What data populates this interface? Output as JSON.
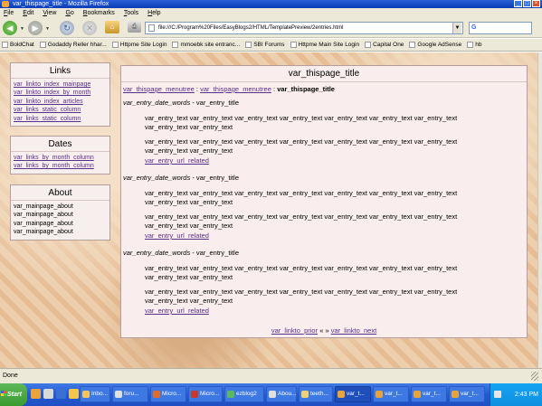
{
  "window": {
    "title": "var_thispage_title - Mozilla Firefox"
  },
  "menu": [
    "File",
    "Edit",
    "View",
    "Go",
    "Bookmarks",
    "Tools",
    "Help"
  ],
  "toolbar": {
    "url": "file:///C:/Program%20Files/EasyBlogs2/HTML/TemplatePreview/2entries.html"
  },
  "bookmarks": [
    "BoldChat",
    "Godaddy Reller hhar...",
    "Httpme Site Login",
    "mmoebk site entranc...",
    "SBI Forums",
    "Httpme Main Site Login",
    "Capital One",
    "Google AdSense",
    "hb"
  ],
  "sidebar": {
    "links": {
      "title": "Links",
      "items": [
        "var_linkto_index_mainpage",
        "var_linkto_index_by_month",
        "var_linkto_index_articles",
        "var_links_static_column",
        "var_links_static_column"
      ]
    },
    "dates": {
      "title": "Dates",
      "items": [
        "var_links_by_month_column",
        "var_links_by_month_column"
      ]
    },
    "about": {
      "title": "About",
      "items": [
        "var_mainpage_about",
        "var_mainpage_about",
        "var_mainpage_about",
        "var_mainpage_about"
      ]
    }
  },
  "main": {
    "title": "var_thispage_title",
    "breadcrumb": {
      "link1": "var_thispage_menutree",
      "sep1": ":",
      "link2": "var_thispage_menutree",
      "sep2": ":",
      "current": "var_thispage_title"
    },
    "entries": [
      {
        "date_words": "var_entry_date_words",
        "dash": "-",
        "title": "var_entry_title",
        "para1": "var_entry_text var_entry_text var_entry_text var_entry_text var_entry_text var_entry_text var_entry_text var_entry_text var_entry_text",
        "para2": "var_entry_text var_entry_text var_entry_text var_entry_text var_entry_text var_entry_text var_entry_text var_entry_text var_entry_text",
        "related": "var_entry_url_related"
      },
      {
        "date_words": "var_entry_date_words",
        "dash": "-",
        "title": "var_entry_title",
        "para1": "var_entry_text var_entry_text var_entry_text var_entry_text var_entry_text var_entry_text var_entry_text var_entry_text var_entry_text",
        "para2": "var_entry_text var_entry_text var_entry_text var_entry_text var_entry_text var_entry_text var_entry_text var_entry_text var_entry_text",
        "related": "var_entry_url_related"
      },
      {
        "date_words": "var_entry_date_words",
        "dash": "-",
        "title": "var_entry_title",
        "para1": "var_entry_text var_entry_text var_entry_text var_entry_text var_entry_text var_entry_text var_entry_text var_entry_text var_entry_text",
        "para2": "var_entry_text var_entry_text var_entry_text var_entry_text var_entry_text var_entry_text var_entry_text var_entry_text var_entry_text",
        "related": "var_entry_url_related"
      }
    ],
    "pager": {
      "prior": "var_linkto_prior",
      "sep_left": "«",
      "sep_right": "»",
      "next": "var_linkto_next"
    }
  },
  "status": {
    "text": "Done"
  },
  "taskbar": {
    "start": "Start",
    "tasks": [
      "Inbo...",
      "foru...",
      "Micro...",
      "Micro...",
      "ezblog2",
      "Abou...",
      "teeth...",
      "var_t...",
      "var_t...",
      "var_t...",
      "var_t..."
    ],
    "clock": "2:43 PM"
  }
}
